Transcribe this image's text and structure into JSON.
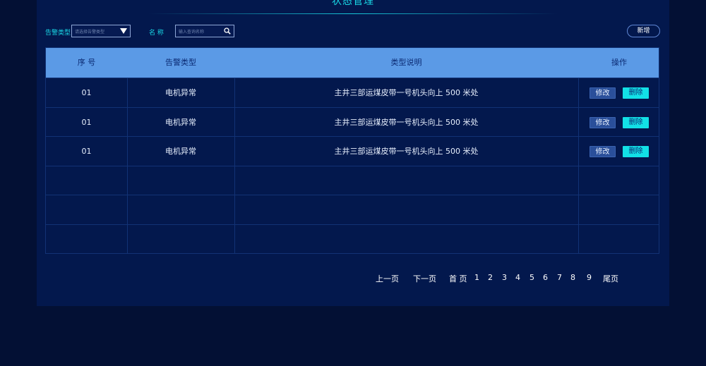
{
  "page": {
    "title": "状态管理"
  },
  "filters": {
    "alarm_type_label": "告警类型",
    "alarm_type_placeholder": "请选择告警类型",
    "name_label": "名 称",
    "name_placeholder": "输入查询名称"
  },
  "toolbar": {
    "add_label": "新增"
  },
  "table": {
    "headers": [
      "序 号",
      "告警类型",
      "类型说明",
      "操作"
    ],
    "rows": [
      {
        "index": "01",
        "type": "电机异常",
        "desc": "主井三部运煤皮带一号机头向上 500 米处",
        "edit": "修改",
        "delete": "删除"
      },
      {
        "index": "01",
        "type": "电机异常",
        "desc": "主井三部运煤皮带一号机头向上 500 米处",
        "edit": "修改",
        "delete": "删除"
      },
      {
        "index": "01",
        "type": "电机异常",
        "desc": "主井三部运煤皮带一号机头向上 500 米处",
        "edit": "修改",
        "delete": "删除"
      }
    ]
  },
  "pagination": {
    "prev": "上一页",
    "next": "下一页",
    "first": "首 页",
    "pages": [
      "1",
      "2",
      "3",
      "4",
      "5",
      "6",
      "7",
      "8",
      "9"
    ],
    "last": "尾页"
  },
  "colors": {
    "background": "#031034",
    "panel": "#03184d",
    "accent": "#19d8e6",
    "header": "#5b9ae6",
    "delete_button": "#12e0e6",
    "edit_button": "#2a4f9a"
  }
}
